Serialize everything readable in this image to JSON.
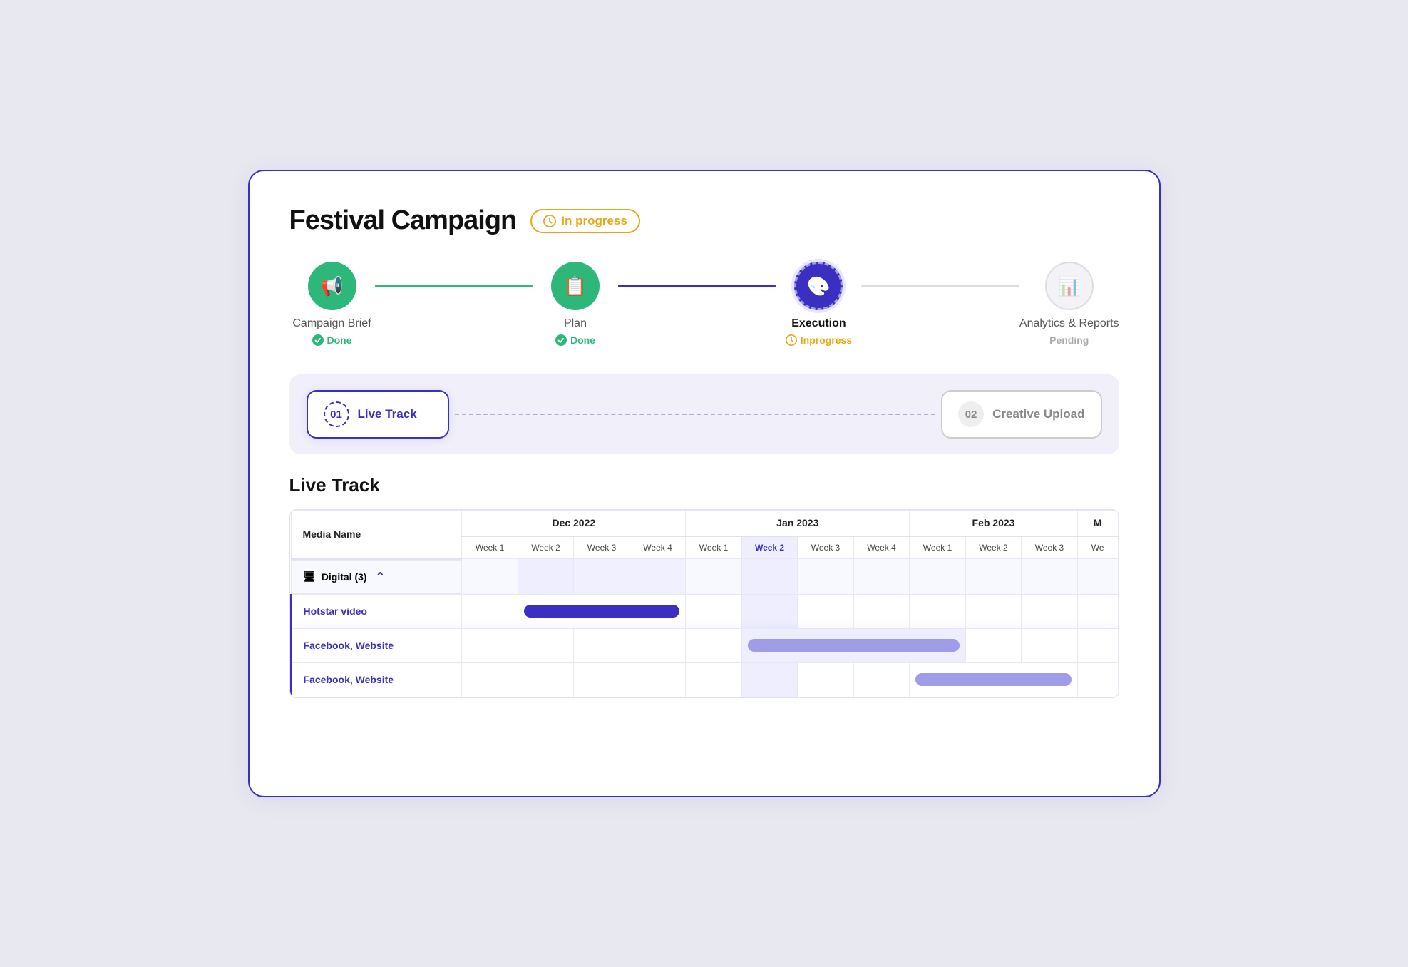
{
  "header": {
    "title": "Festival Campaign",
    "status_label": "In progress"
  },
  "stepper": {
    "steps": [
      {
        "id": "campaign-brief",
        "label": "Campaign Brief",
        "status": "Done",
        "state": "green",
        "icon": "📢"
      },
      {
        "id": "plan",
        "label": "Plan",
        "status": "Done",
        "state": "green",
        "icon": "📋"
      },
      {
        "id": "execution",
        "label": "Execution",
        "status": "Inprogress",
        "state": "active",
        "icon": "🎨"
      },
      {
        "id": "analytics",
        "label": "Analytics & Reports",
        "status": "Pending",
        "state": "inactive",
        "icon": "📊"
      }
    ]
  },
  "sub_steps": [
    {
      "num": "01",
      "label": "Live Track",
      "state": "active"
    },
    {
      "num": "02",
      "label": "Creative Upload",
      "state": "inactive"
    }
  ],
  "live_track": {
    "title": "Live Track",
    "columns": {
      "media_col": "Media Name",
      "months": [
        {
          "label": "Dec 2022",
          "span": 4
        },
        {
          "label": "Jan 2023",
          "span": 4
        },
        {
          "label": "Feb 2023",
          "span": 3
        },
        {
          "label": "M",
          "span": 1
        }
      ],
      "weeks": [
        "Week 1",
        "Week 2",
        "Week 3",
        "Week 4",
        "Week 1",
        "Week 2",
        "Week 3",
        "Week 4",
        "Week 1",
        "Week 2",
        "Week 3",
        "We"
      ]
    },
    "rows": [
      {
        "type": "group",
        "label": "Digital (3)",
        "icon": "🖥",
        "expanded": true
      },
      {
        "type": "item",
        "label": "Hotstar video",
        "bar_start": 1,
        "bar_end": 4,
        "bar_type": "dark"
      },
      {
        "type": "item",
        "label": "Facebook, Website",
        "bar_start": 4,
        "bar_end": 9,
        "bar_type": "light",
        "elevated": true
      },
      {
        "type": "item",
        "label": "Facebook, Website",
        "bar_start": 7,
        "bar_end": 11,
        "bar_type": "light"
      }
    ]
  }
}
